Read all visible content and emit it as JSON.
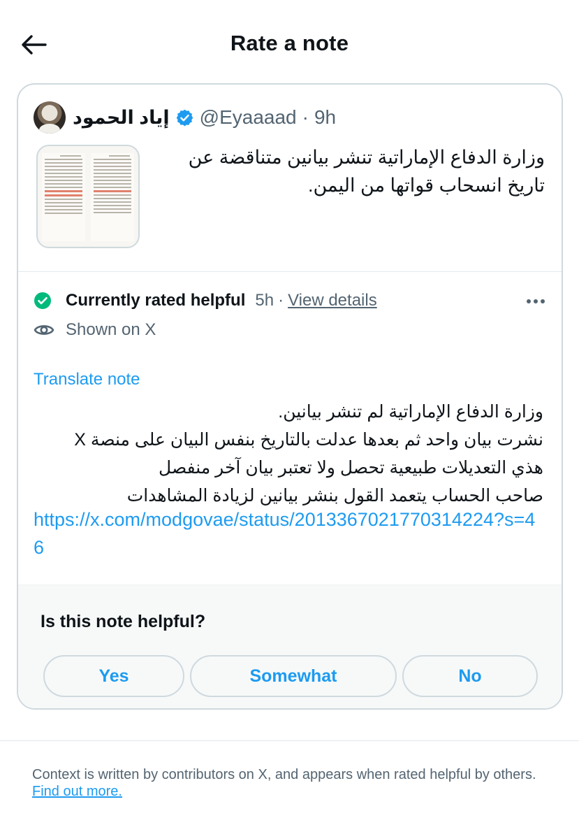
{
  "header": {
    "title": "Rate a note"
  },
  "tweet": {
    "author_name": "إياد الحمود",
    "handle": "@Eyaaaad",
    "separator": "·",
    "time": "9h",
    "text": "وزارة الدفاع الإماراتية تنشر بيانين متناقضة عن تاريخ انسحاب قواتها من اليمن."
  },
  "note": {
    "status": "Currently rated helpful",
    "time": "5h",
    "separator": "·",
    "view_details": "View details",
    "shown": "Shown on X",
    "translate": "Translate note",
    "lines": [
      "وزارة الدفاع الإماراتية لم تنشر بيانين.",
      "نشرت بيان واحد ثم بعدها عدلت بالتاريخ بنفس البيان على منصة X",
      "هذي التعديلات طبيعية تحصل ولا تعتبر بيان آخر منفصل",
      "صاحب الحساب يتعمد القول بنشر بيانين لزيادة المشاهدات"
    ],
    "link": "https://x.com/modgovae/status/2013367021770314224?s=46",
    "status_color": "#00ba7c",
    "link_color": "#1d9bf0"
  },
  "rating": {
    "question": "Is this note helpful?",
    "yes": "Yes",
    "somewhat": "Somewhat",
    "no": "No"
  },
  "footer": {
    "text": "Context is written by contributors on X, and appears when rated helpful by others.",
    "link": "Find out more."
  }
}
